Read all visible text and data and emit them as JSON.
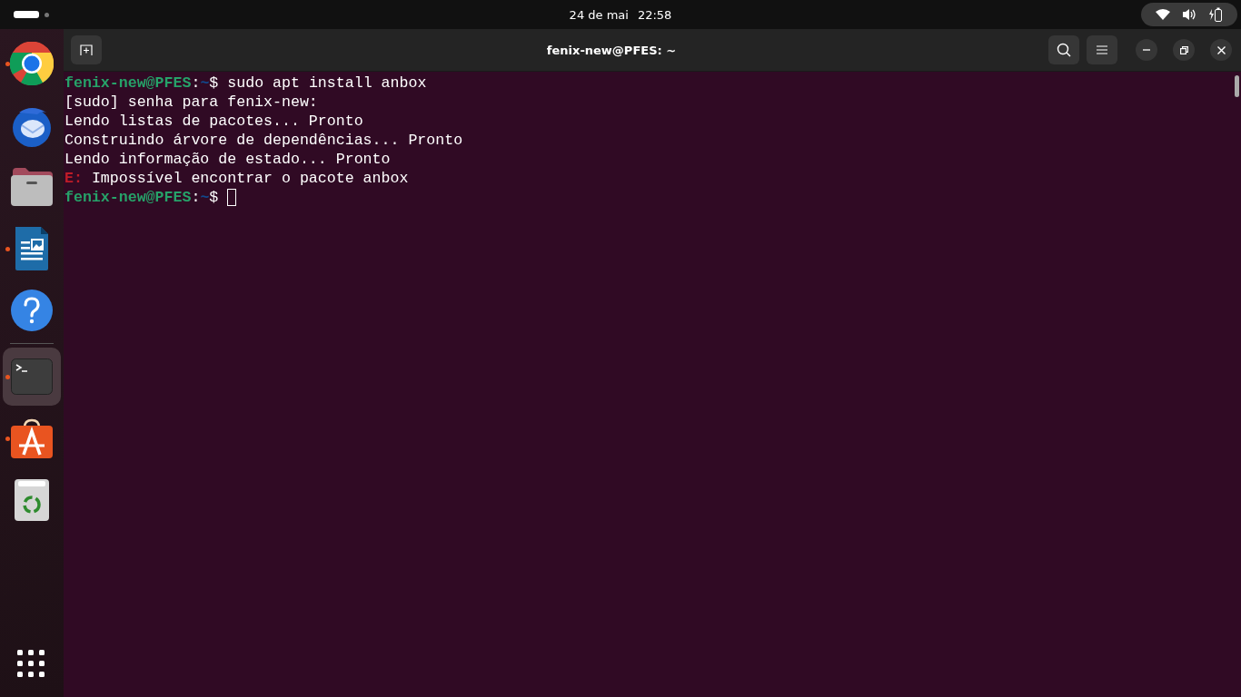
{
  "topbar": {
    "workspaces": [
      {
        "selected": true
      },
      {
        "selected": false
      }
    ],
    "date": "24 de mai",
    "time": "22:58"
  },
  "dock": {
    "items": [
      {
        "kind": "chrome",
        "running": true,
        "selected": false
      },
      {
        "kind": "mail",
        "running": false,
        "selected": false
      },
      {
        "kind": "files",
        "running": false,
        "selected": false
      },
      {
        "kind": "writer",
        "running": true,
        "selected": false
      },
      {
        "kind": "help",
        "running": false,
        "selected": false
      },
      {
        "kind": "separator"
      },
      {
        "kind": "terminal",
        "running": true,
        "selected": true
      },
      {
        "kind": "store",
        "running": true,
        "selected": false
      },
      {
        "kind": "trash",
        "running": false,
        "selected": false
      }
    ]
  },
  "window": {
    "title": "fenix-new@PFES: ~"
  },
  "terminal": {
    "lines": [
      {
        "segments": [
          {
            "kind": "user",
            "text": "fenix-new@PFES"
          },
          {
            "kind": "plain",
            "text": ":"
          },
          {
            "kind": "path",
            "text": "~"
          },
          {
            "kind": "plain",
            "text": "$ sudo apt install anbox"
          }
        ],
        "cursor": false
      },
      {
        "segments": [
          {
            "kind": "plain",
            "text": "[sudo] senha para fenix-new:"
          }
        ],
        "cursor": false
      },
      {
        "segments": [
          {
            "kind": "plain",
            "text": "Lendo listas de pacotes... Pronto"
          }
        ],
        "cursor": false
      },
      {
        "segments": [
          {
            "kind": "plain",
            "text": "Construindo árvore de dependências... Pronto"
          }
        ],
        "cursor": false
      },
      {
        "segments": [
          {
            "kind": "plain",
            "text": "Lendo informação de estado... Pronto"
          }
        ],
        "cursor": false
      },
      {
        "segments": [
          {
            "kind": "error",
            "text": "E:"
          },
          {
            "kind": "plain",
            "text": " Impossível encontrar o pacote anbox"
          }
        ],
        "cursor": false
      },
      {
        "segments": [
          {
            "kind": "user",
            "text": "fenix-new@PFES"
          },
          {
            "kind": "plain",
            "text": ":"
          },
          {
            "kind": "path",
            "text": "~"
          },
          {
            "kind": "plain",
            "text": "$ "
          }
        ],
        "cursor": true
      }
    ]
  }
}
